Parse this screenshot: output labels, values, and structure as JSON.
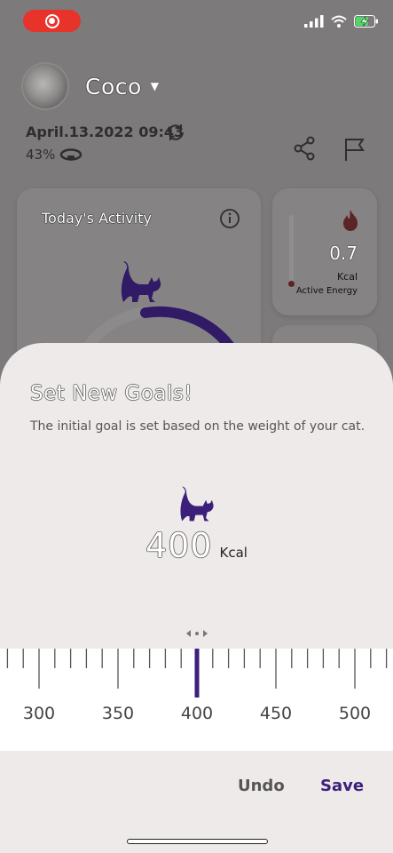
{
  "pet": {
    "name": "Coco",
    "datetime": "April.13.2022 09:43",
    "battery": "43%"
  },
  "activity_card": {
    "title": "Today's Activity"
  },
  "energy_card": {
    "value": "0.7",
    "unit": "Kcal",
    "label": "Active Energy"
  },
  "sheet": {
    "title": "Set New Goals!",
    "subtitle": "The initial goal is set based on the weight of your cat.",
    "goal_value": "400",
    "goal_unit": "Kcal",
    "ruler": {
      "selected": 400,
      "labels": [
        "300",
        "350",
        "400",
        "450",
        "500"
      ]
    },
    "undo_label": "Undo",
    "save_label": "Save"
  },
  "colors": {
    "accent": "#3c1f7a",
    "recording": "#e8332b",
    "sheet_bg": "#efeaea",
    "dim_bg": "#7c7a7b"
  },
  "icons": [
    "record-icon",
    "signal-icon",
    "wifi-icon",
    "battery-charging-icon",
    "chevron-down-icon",
    "refresh-icon",
    "collar-icon",
    "share-icon",
    "flag-icon",
    "info-icon",
    "cat-icon",
    "flame-icon",
    "drag-arrows-icon"
  ]
}
